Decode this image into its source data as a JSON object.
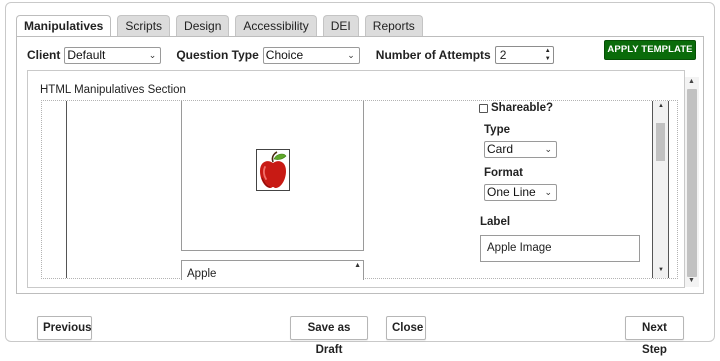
{
  "tabs": [
    {
      "label": "Manipulatives",
      "active": true
    },
    {
      "label": "Scripts",
      "active": false
    },
    {
      "label": "Design",
      "active": false
    },
    {
      "label": "Accessibility",
      "active": false
    },
    {
      "label": "DEI",
      "active": false
    },
    {
      "label": "Reports",
      "active": false
    }
  ],
  "toolbar": {
    "client_label": "Client",
    "client_value": "Default",
    "question_type_label": "Question Type",
    "question_type_value": "Choice",
    "attempts_label": "Number of Attempts",
    "attempts_value": "2",
    "apply_template_label": "APPLY TEMPLATE"
  },
  "section": {
    "title": "HTML Manipulatives Section",
    "item_label": "Apple",
    "shareable_label": "Shareable?",
    "shareable_checked": false,
    "type_label": "Type",
    "type_value": "Card",
    "format_label": "Format",
    "format_value": "One Line",
    "label_label": "Label",
    "label_value": "Apple Image"
  },
  "footer": {
    "previous_label": "Previous",
    "save_draft_label": "Save as Draft",
    "close_label": "Close",
    "next_step_label": "Next Step"
  },
  "colors": {
    "apply_button": "#0a6b0a",
    "tab_active": "#ffffff",
    "tab_inactive": "#dcdcdc"
  },
  "icons": {
    "image": "apple-icon",
    "dropdown": "chevron-down-icon",
    "spinner": "spinner-arrows-icon",
    "checkbox": "checkbox-icon"
  }
}
